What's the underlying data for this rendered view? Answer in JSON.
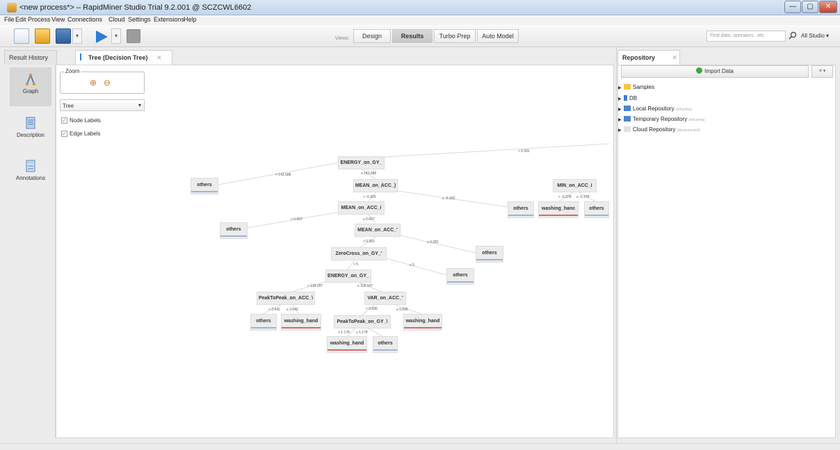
{
  "window": {
    "title": "<new process*> – RapidMiner Studio Trial 9.2.001 @ SCZCWL6602",
    "controls": {
      "minimize": "—",
      "maximize": "▢",
      "close": "✕"
    }
  },
  "menu": [
    "File",
    "Edit",
    "Process",
    "View",
    "Connections",
    "Cloud",
    "Settings",
    "Extensions",
    "Help"
  ],
  "toolbar": {
    "views_label": "Views:",
    "views": [
      "Design",
      "Results",
      "Turbo Prep",
      "Auto Model"
    ],
    "active_view": "Results",
    "search_placeholder": "Find data, operators...etc",
    "studio_dropdown": "All Studio ▾",
    "dropdown_arrow": "▾"
  },
  "result_tabs": {
    "history": "Result History",
    "tree_tab": "Tree (Decision Tree)",
    "close": "✕"
  },
  "sidebar": [
    {
      "label": "Graph",
      "icon": "graph-icon"
    },
    {
      "label": "Description",
      "icon": "description-icon"
    },
    {
      "label": "Annotations",
      "icon": "annotations-icon"
    }
  ],
  "controls": {
    "zoom_label": "Zoom",
    "zoom_in": "⊕",
    "zoom_out": "⊖",
    "layout_value": "Tree",
    "layout_arrow": "▾",
    "node_labels": "Node Labels",
    "edge_labels": "Edge Labels",
    "check": "✓"
  },
  "tree": {
    "nodes": {
      "root": "ENERGY_on_GY_",
      "n_mean_acc_y": "MEAN_on_ACC_)",
      "n_min_acc": "MIN_on_ACC_i",
      "n_mean_acc_i": "MEAN_on_ACC_i",
      "n_mean_acc_2": "MEAN_on_ACC_'",
      "n_zerocross": "ZeroCross_on_GY_'",
      "n_energy2": "ENERGY_on_GY_",
      "n_p2p_acc": "PeakToPeak_on_ACC_\\",
      "n_var_acc": "VAR_on_ACC_'",
      "n_p2p_gy": "PeakToPeak_on_GY_\\"
    },
    "leaves": {
      "l1": "others",
      "l2": "others",
      "l3": "washing_hanc",
      "l4": "others",
      "l5": "others",
      "l6": "others",
      "l7": "others",
      "l8": "others",
      "l9": "others",
      "l10": "washing_hand",
      "l11": "washing_hand",
      "l12": "washing_hand",
      "l13": "others"
    },
    "edges": {
      "e0": "> 0.281",
      "e1": "> 142.688",
      "e2": "≤ 142.688",
      "e3": "≤ -0.325",
      "e4": "> -0.325",
      "e5": "> -0.378",
      "e6": "≤ -0.378",
      "e7": "> 0.607",
      "e8": "≤ 0.607",
      "e9": "> 0.281",
      "e10": "≤ 0.281",
      "e11": "> 5",
      "e12": "≤ 5",
      "e13": "> 118.187",
      "e14": "≤ 118.187",
      "e15": "> 2.642",
      "e16": "≤ 2.642",
      "e17": "> 0.696",
      "e18": "≤ 0.696",
      "e19": "> 1.178",
      "e20": "≤ 1.178"
    },
    "colors": {
      "others": "#9fb3d4",
      "washing_hand": "#d46a6a"
    }
  },
  "repository": {
    "tab": "Repository",
    "close": "✕",
    "import_button": "Import Data",
    "menu_button": "≡ ▾",
    "items": [
      {
        "label": "Samples",
        "sub": ""
      },
      {
        "label": "DB",
        "sub": ""
      },
      {
        "label": "Local Repository",
        "sub": "(mhumha)"
      },
      {
        "label": "Temporary Repository",
        "sub": "(mhumha)"
      },
      {
        "label": "Cloud Repository",
        "sub": "(disconnected)"
      }
    ]
  }
}
